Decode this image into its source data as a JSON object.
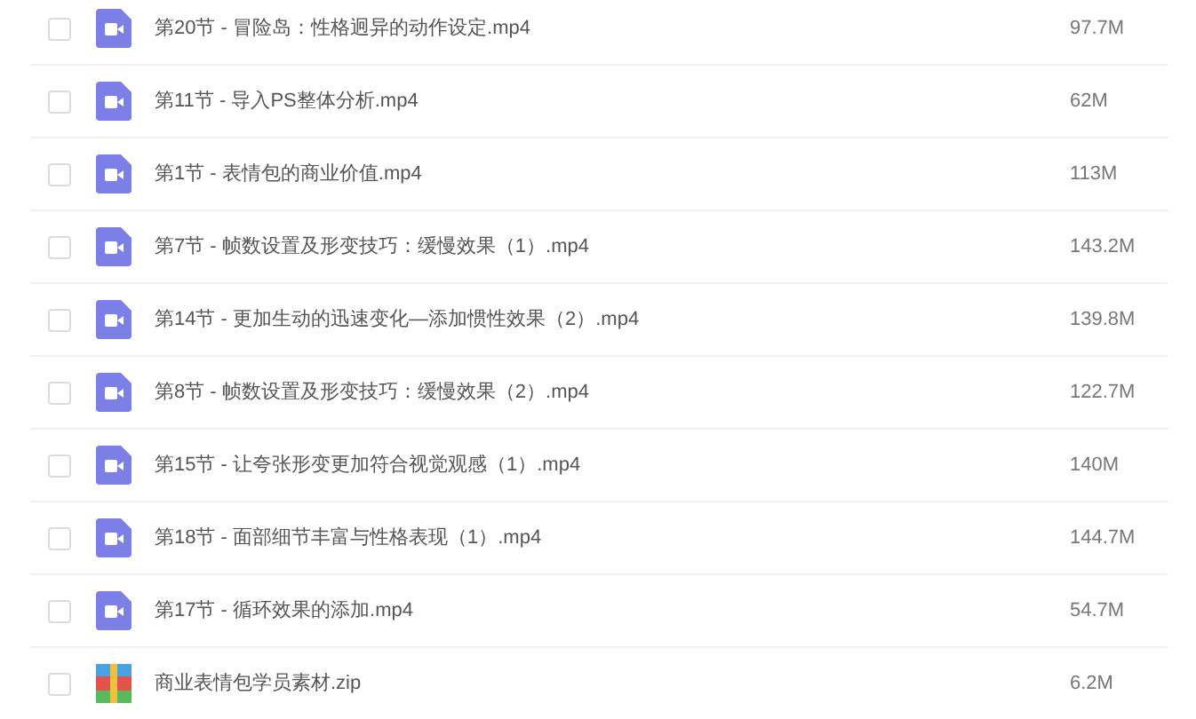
{
  "files": [
    {
      "name": "第20节 - 冒险岛：性格迥异的动作设定.mp4",
      "size": "97.7M",
      "kind": "video",
      "checked": false
    },
    {
      "name": "第11节 - 导入PS整体分析.mp4",
      "size": "62M",
      "kind": "video",
      "checked": false
    },
    {
      "name": "第1节 - 表情包的商业价值.mp4",
      "size": "113M",
      "kind": "video",
      "checked": false
    },
    {
      "name": "第7节 - 帧数设置及形变技巧：缓慢效果（1）.mp4",
      "size": "143.2M",
      "kind": "video",
      "checked": false
    },
    {
      "name": "第14节 - 更加生动的迅速变化—添加惯性效果（2）.mp4",
      "size": "139.8M",
      "kind": "video",
      "checked": false
    },
    {
      "name": "第8节 - 帧数设置及形变技巧：缓慢效果（2）.mp4",
      "size": "122.7M",
      "kind": "video",
      "checked": false
    },
    {
      "name": "第15节 - 让夸张形变更加符合视觉观感（1）.mp4",
      "size": "140M",
      "kind": "video",
      "checked": false
    },
    {
      "name": "第18节 - 面部细节丰富与性格表现（1）.mp4",
      "size": "144.7M",
      "kind": "video",
      "checked": false
    },
    {
      "name": "第17节 - 循环效果的添加.mp4",
      "size": "54.7M",
      "kind": "video",
      "checked": false
    },
    {
      "name": "商业表情包学员素材.zip",
      "size": "6.2M",
      "kind": "archive",
      "checked": false
    }
  ]
}
